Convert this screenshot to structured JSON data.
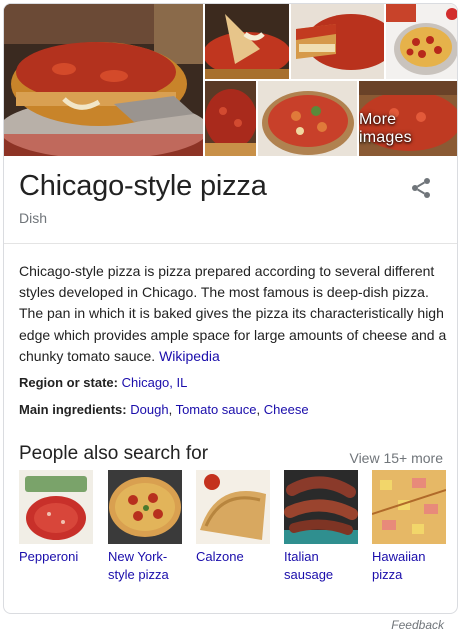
{
  "images": {
    "more_label": "More images"
  },
  "entity": {
    "title": "Chicago-style pizza",
    "subtitle": "Dish"
  },
  "description": {
    "text": "Chicago-style pizza is pizza prepared according to several different styles developed in Chicago. The most famous is deep-dish pizza. The pan in which it is baked gives the pizza its characteristically high edge which provides ample space for large amounts of cheese and a chunky tomato sauce.",
    "source_link": "Wikipedia"
  },
  "facts": {
    "region_label": "Region or state:",
    "region_value": "Chicago, IL",
    "ingredients_label": "Main ingredients:",
    "ingredients": [
      "Dough",
      "Tomato sauce",
      "Cheese"
    ],
    "separator": ", "
  },
  "people_also_search": {
    "title": "People also search for",
    "more_label": "View 15+ more",
    "items": [
      {
        "label": "Pepperoni"
      },
      {
        "label": "New York-style pizza"
      },
      {
        "label": "Calzone"
      },
      {
        "label": "Italian sausage"
      },
      {
        "label": "Hawaiian pizza"
      }
    ]
  },
  "footer": {
    "feedback": "Feedback"
  },
  "colors": {
    "link": "#1a0dab",
    "muted": "#70757a",
    "text": "#222222",
    "border": "#dadce0"
  },
  "icons": [
    "share-icon"
  ]
}
